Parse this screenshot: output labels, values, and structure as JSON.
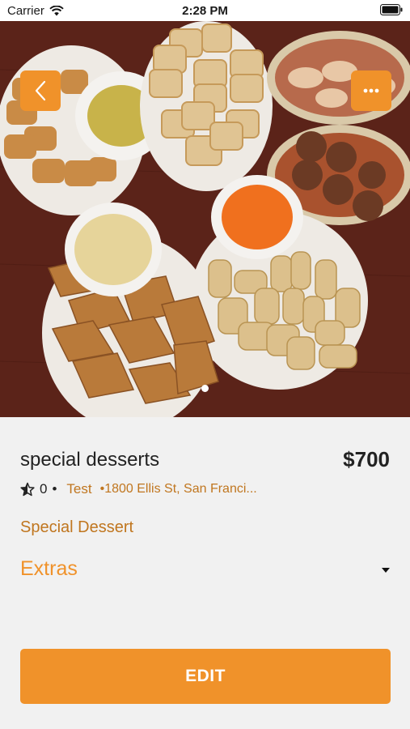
{
  "status": {
    "carrier": "Carrier",
    "time": "2:28 PM"
  },
  "item": {
    "title": "special desserts",
    "price": "$700",
    "rating": "0",
    "vendor": "Test",
    "address": "•1800 Ellis St, San Franci...",
    "category": "Special Dessert",
    "extras_label": "Extras",
    "image_dots": 1,
    "active_dot": 0
  },
  "actions": {
    "edit_label": "EDIT"
  },
  "icons": {
    "back": "chevron-left-icon",
    "more": "ellipsis-icon",
    "star": "star-half-icon",
    "caret": "caret-down-icon"
  },
  "colors": {
    "accent": "#f0922a",
    "accent_text": "#c0761f",
    "background": "#f1f1f1"
  }
}
